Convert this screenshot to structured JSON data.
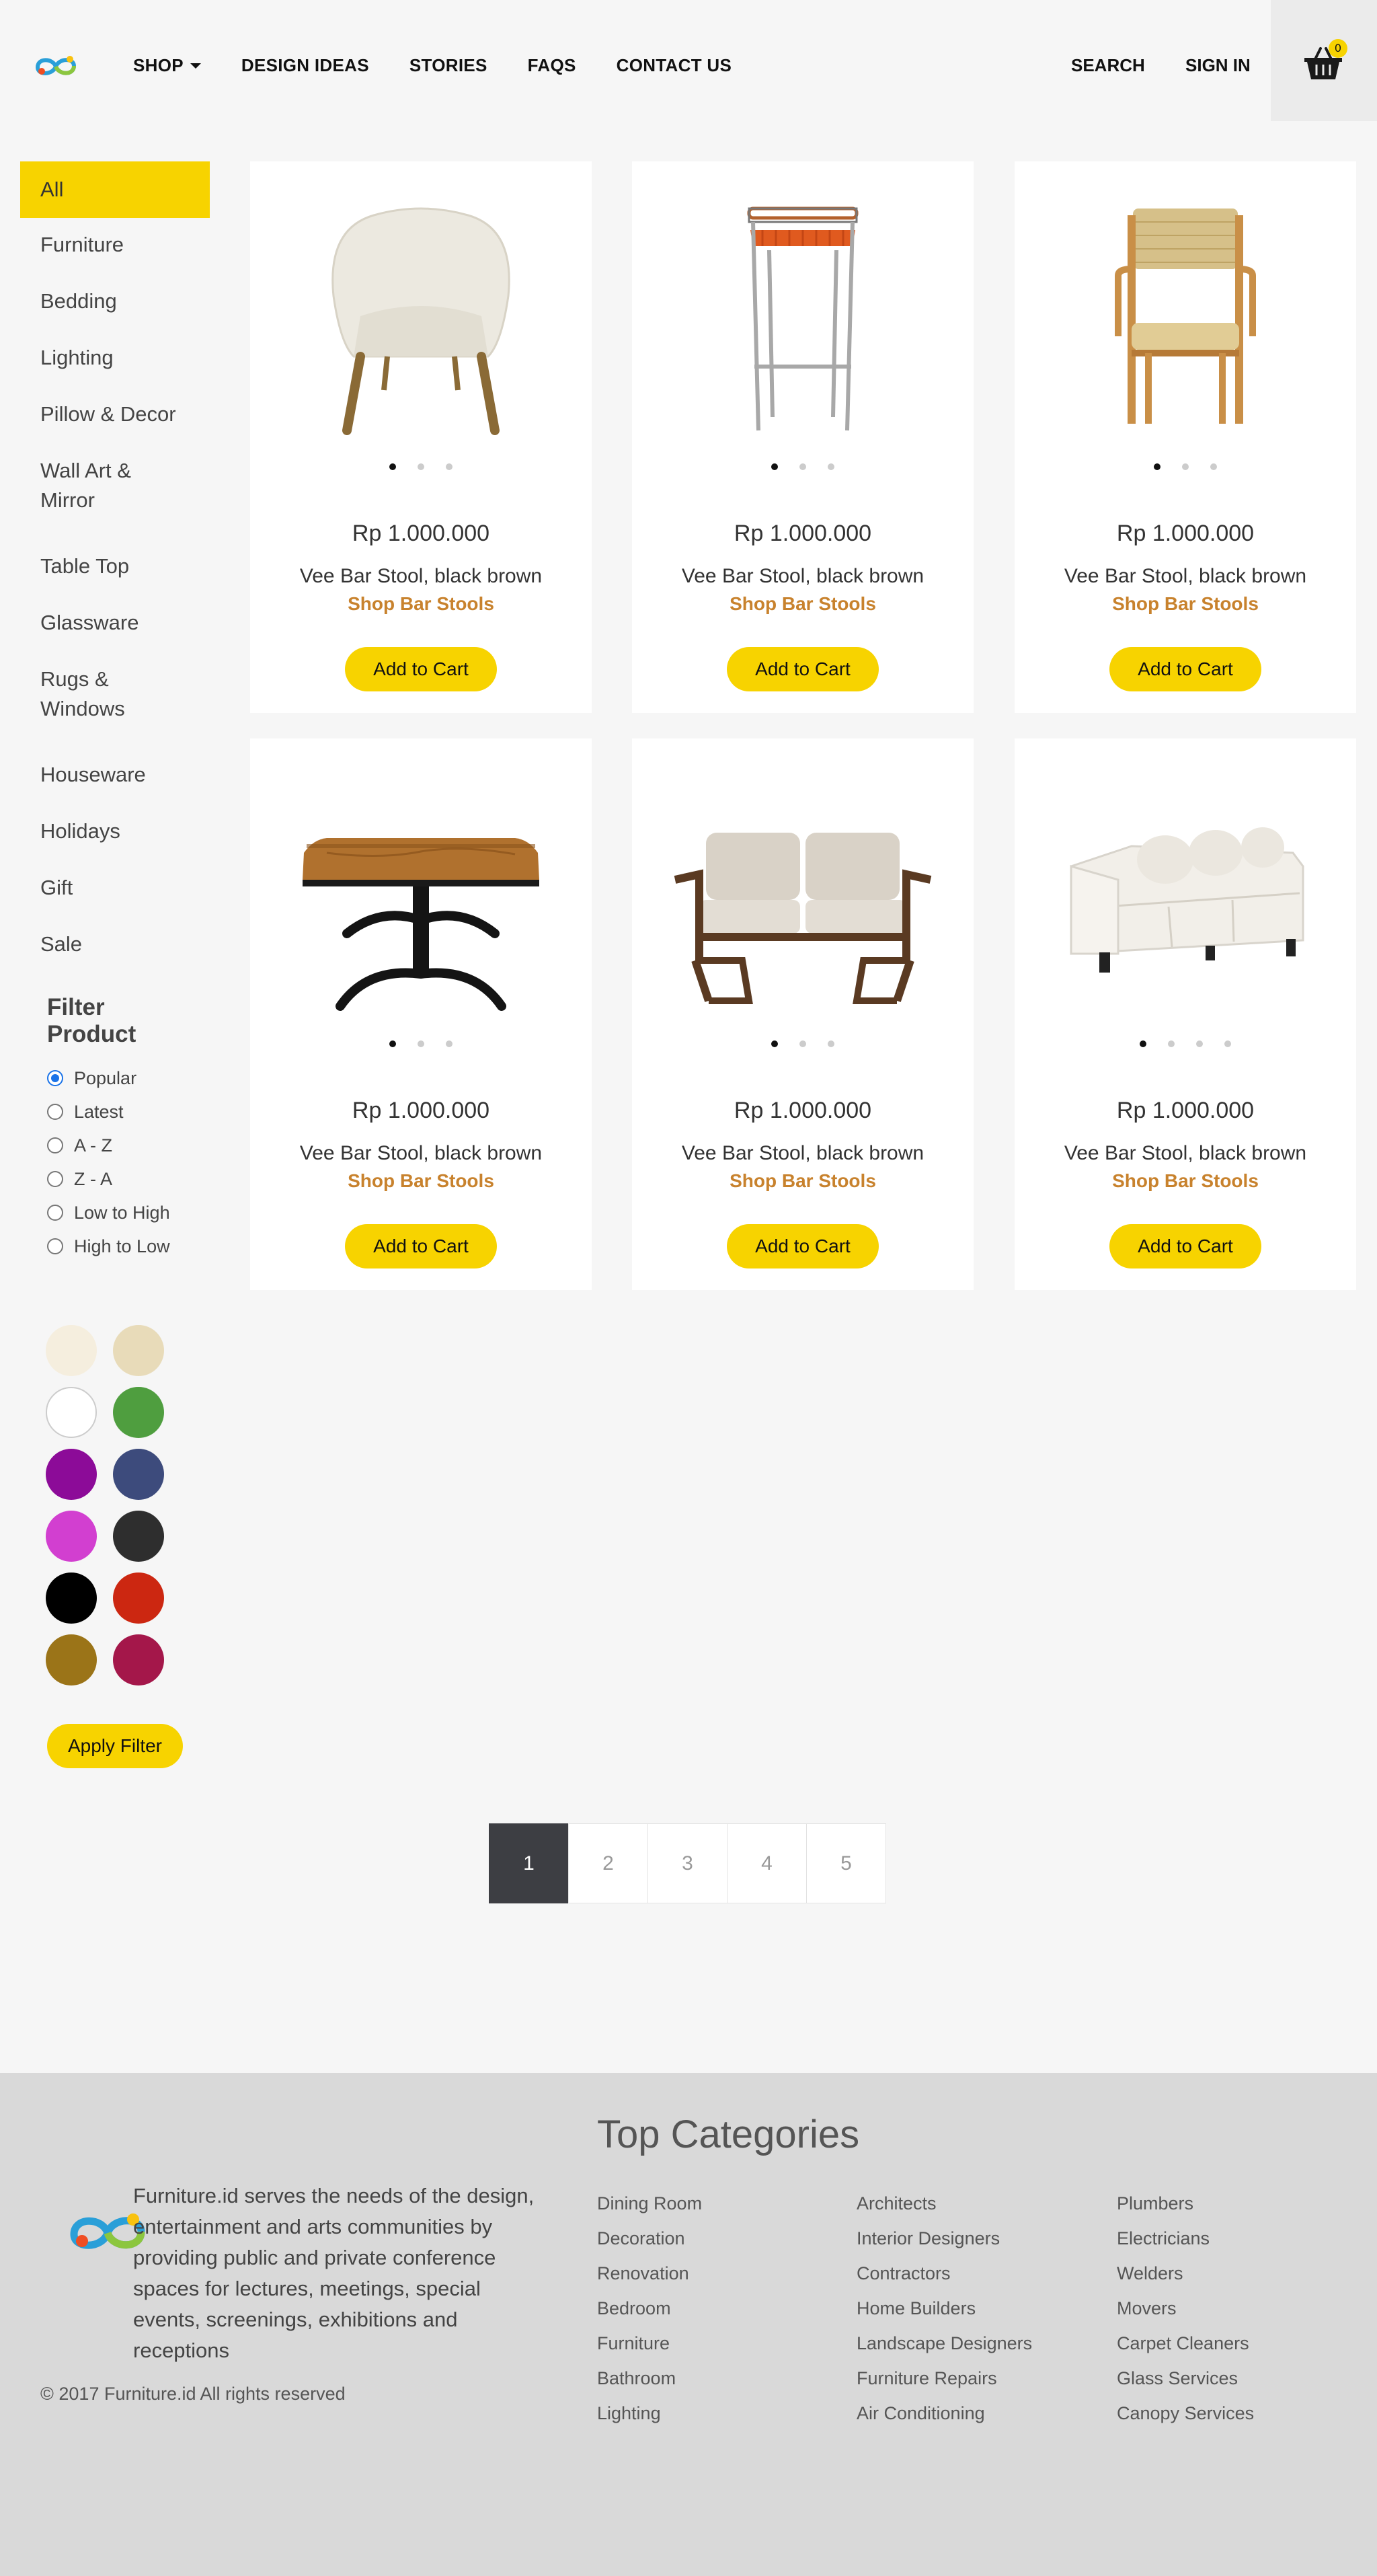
{
  "nav": {
    "items": [
      {
        "label": "SHOP",
        "name": "nav-shop"
      },
      {
        "label": "DESIGN IDEAS",
        "name": "nav-design-ideas"
      },
      {
        "label": "STORIES",
        "name": "nav-stories"
      },
      {
        "label": "FAQS",
        "name": "nav-faqs"
      },
      {
        "label": "CONTACT US",
        "name": "nav-contact-us"
      }
    ],
    "search": "SEARCH",
    "signin": "SIGN IN",
    "cart_count": "0"
  },
  "categories": [
    "All",
    "Furniture",
    "Bedding",
    "Lighting",
    "Pillow & Decor",
    "Wall Art & Mirror",
    "Table Top",
    "Glassware",
    "Rugs & Windows",
    "Houseware",
    "Holidays",
    "Gift",
    "Sale"
  ],
  "filter": {
    "title": "Filter Product",
    "options": [
      "Popular",
      "Latest",
      "A - Z",
      "Z - A",
      "Low to High",
      "High to Low"
    ],
    "selected": "Popular",
    "swatch_colors": [
      "#f5eede",
      "#e8dbb9",
      "#ffffff",
      "#4f9e3f",
      "#8c0b98",
      "#3d4b7c",
      "#d23fd0",
      "#2e2e2e",
      "#000000",
      "#cc2711",
      "#9b7418",
      "#a4174a"
    ],
    "apply_label": "Apply Filter"
  },
  "products": [
    {
      "image": "armchair",
      "price": "Rp 1.000.000",
      "name": "Vee Bar Stool, black brown",
      "link": "Shop Bar Stools",
      "button": "Add to Cart",
      "dots": 3
    },
    {
      "image": "bar-stool",
      "price": "Rp 1.000.000",
      "name": "Vee Bar Stool, black brown",
      "link": "Shop Bar Stools",
      "button": "Add to Cart",
      "dots": 3
    },
    {
      "image": "wicker-chair",
      "price": "Rp 1.000.000",
      "name": "Vee Bar Stool, black brown",
      "link": "Shop Bar Stools",
      "button": "Add to Cart",
      "dots": 3
    },
    {
      "image": "dining-table",
      "price": "Rp 1.000.000",
      "name": "Vee Bar Stool, black brown",
      "link": "Shop Bar Stools",
      "button": "Add to Cart",
      "dots": 3
    },
    {
      "image": "loveseat",
      "price": "Rp 1.000.000",
      "name": "Vee Bar Stool, black brown",
      "link": "Shop Bar Stools",
      "button": "Add to Cart",
      "dots": 3
    },
    {
      "image": "sofa",
      "price": "Rp 1.000.000",
      "name": "Vee Bar Stool, black brown",
      "link": "Shop Bar Stools",
      "button": "Add to Cart",
      "dots": 4
    }
  ],
  "pagination": {
    "pages": [
      "1",
      "2",
      "3",
      "4",
      "5"
    ],
    "current": "1"
  },
  "footer": {
    "about": "Furniture.id serves the needs of the design, entertainment and arts communities by providing public and private conference spaces for lectures, meetings, special events, screenings, exhibitions and receptions",
    "copyright": "© 2017 Furniture.id All rights reserved",
    "categories_title": "Top Categories",
    "columns": [
      [
        "Dining Room",
        "Decoration",
        "Renovation",
        "Bedroom",
        "Furniture",
        "Bathroom",
        "Lighting"
      ],
      [
        "Architects",
        "Interior Designers",
        "Contractors",
        "Home Builders",
        "Landscape Designers",
        "Furniture Repairs",
        "Air Conditioning"
      ],
      [
        "Plumbers",
        "Electricians",
        "Welders",
        "Movers",
        "Carpet Cleaners",
        "Glass Services",
        "Canopy Services"
      ]
    ]
  },
  "colors": {
    "accent": "#f7d300",
    "link": "#c8822d",
    "pager_active": "#3d3e43",
    "footer_bg": "#d9d9d9"
  }
}
